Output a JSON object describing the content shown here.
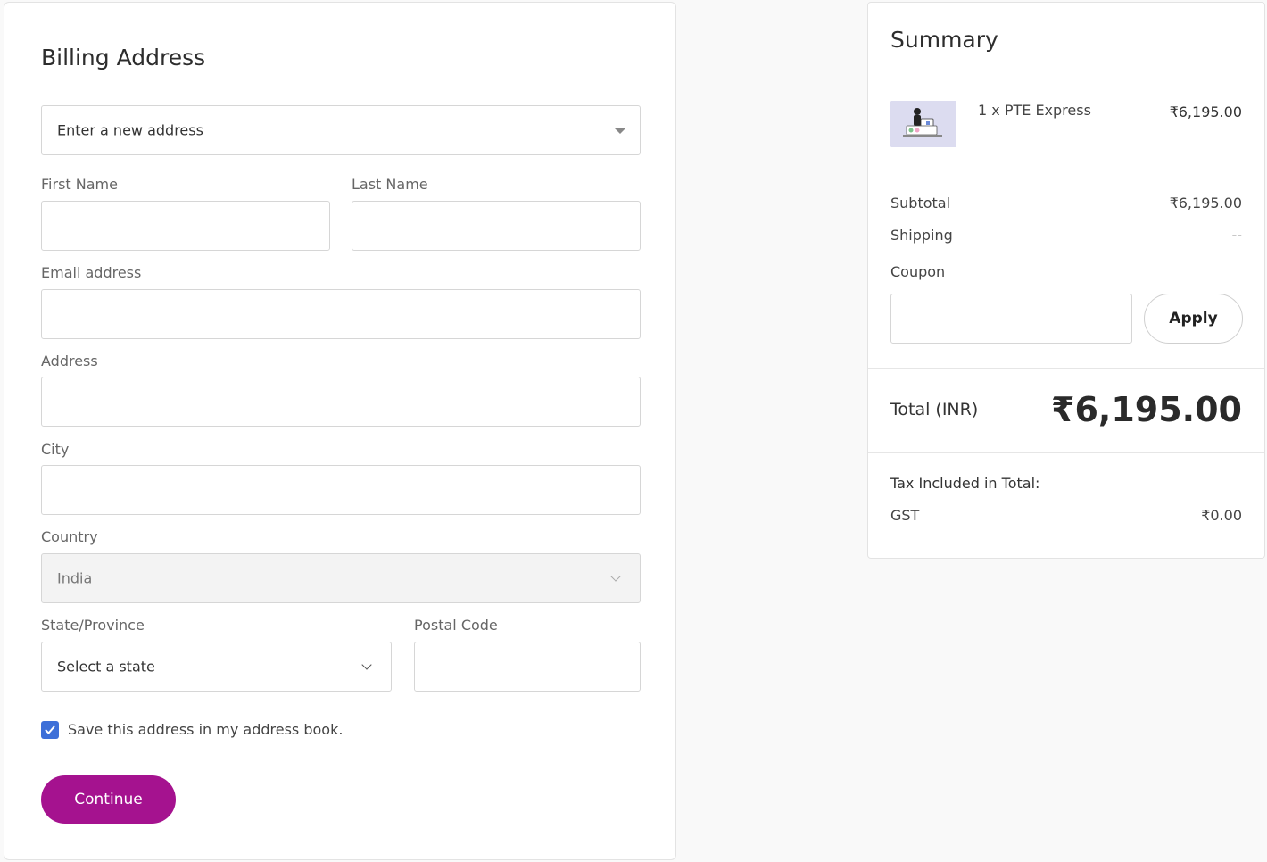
{
  "billing": {
    "title": "Billing Address",
    "address_select": {
      "value": "Enter a new address"
    },
    "first_name": {
      "label": "First Name",
      "value": ""
    },
    "last_name": {
      "label": "Last Name",
      "value": ""
    },
    "email": {
      "label": "Email address",
      "value": ""
    },
    "address": {
      "label": "Address",
      "value": ""
    },
    "city": {
      "label": "City",
      "value": ""
    },
    "country": {
      "label": "Country",
      "value": "India"
    },
    "state": {
      "label": "State/Province",
      "value": "Select a state"
    },
    "postal": {
      "label": "Postal Code",
      "value": ""
    },
    "save_checkbox": {
      "label": "Save this address in my address book.",
      "checked": true
    },
    "continue_label": "Continue"
  },
  "summary": {
    "title": "Summary",
    "item": {
      "name": "1 x PTE Express",
      "price": "₹6,195.00"
    },
    "subtotal": {
      "label": "Subtotal",
      "value": "₹6,195.00"
    },
    "shipping": {
      "label": "Shipping",
      "value": "--"
    },
    "coupon": {
      "label": "Coupon",
      "value": "",
      "apply_label": "Apply"
    },
    "total": {
      "label": "Total (INR)",
      "value": "₹6,195.00"
    },
    "tax": {
      "heading": "Tax Included in Total:",
      "label": "GST",
      "value": "₹0.00"
    }
  },
  "colors": {
    "primary_button": "#a5128f",
    "checkbox": "#3d6fd8"
  }
}
